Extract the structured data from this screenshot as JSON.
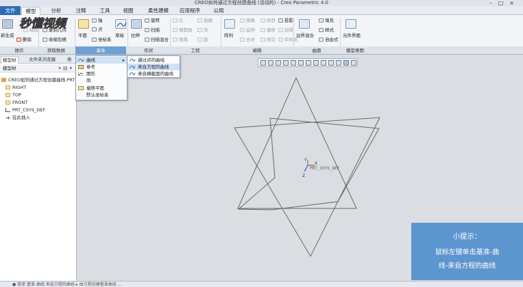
{
  "window": {
    "title": "CREO如何通过方程创建曲线 (活动的) - Creo Parametric 4.0"
  },
  "tabs": [
    "文件",
    "模型",
    "分析",
    "注释",
    "工具",
    "视图",
    "柔性建模",
    "应用程序",
    "公用"
  ],
  "logo_text": "秒懂视频",
  "ribbon": {
    "operations": {
      "regenerate": "新生成",
      "paste": "粘贴",
      "delete": "删除",
      "group_label": "操作"
    },
    "get_data": {
      "copy_geometry": "复制几何",
      "shrinkwrap": "收缩包络",
      "group_label": "获取数据"
    },
    "datum": {
      "plane": "平面",
      "axis": "轴",
      "point": "点",
      "coord_sys": "坐标系",
      "sketch": "草绘",
      "group_label": "基准"
    },
    "shapes": {
      "extrude": "拉伸",
      "revolve": "旋转",
      "sweep": "扫描",
      "swept_blend": "扫描混合",
      "group_label": "形状"
    },
    "engineering": {
      "hole": "孔",
      "round": "倒圆角",
      "chamfer": "倒角",
      "draft": "拔模",
      "shell": "壳",
      "rib": "筋",
      "group_label": "工程"
    },
    "editing": {
      "pattern": "阵列",
      "mirror": "镜像",
      "extend": "延伸",
      "merge": "合并",
      "trim": "修剪",
      "offset": "偏移",
      "intersect": "相交",
      "project": "投影",
      "thicken": "加厚",
      "solidify": "实体化",
      "group_label": "编辑"
    },
    "surfaces": {
      "boundary_blend": "边界混合",
      "fill": "填充",
      "style": "样式",
      "freestyle": "自由式",
      "group_label": "曲面"
    },
    "model_intent": {
      "component_interface": "元件界面",
      "group_label": "模型意图"
    }
  },
  "left_panel": {
    "tabs": [
      "模型树",
      "文件夹浏览器",
      "收藏夹"
    ],
    "tree_header": "模型树",
    "items": [
      "CREO如何通过方程创建曲线.PRT",
      "RIGHT",
      "TOP",
      "FRONT",
      "PRT_CSYS_DEF",
      "在此插入"
    ]
  },
  "datum_menu": {
    "items": [
      "曲线",
      "参考",
      "图形",
      "简",
      "偏移平面",
      "默认坐标系"
    ]
  },
  "curve_submenu": {
    "items": [
      "通过点的曲线",
      "来自方程的曲线",
      "来自横截面的曲线"
    ]
  },
  "model": {
    "csys_label": "PRT_CSYS_DEF",
    "axis_x": "X",
    "axis_y": "Y",
    "axis_z": "Z"
  },
  "tip": {
    "title": "小提示：",
    "line1": "鼠标左键单击基准-曲",
    "line2": "线-来自方程的曲线"
  },
  "status": {
    "text": "● 菜单 基准 曲线 来自方程的曲线 ▸ 由方程创建基准曲线 ..."
  },
  "colors": {
    "file_tab": "#2e6cb5",
    "datum_group_highlight": "#6f9fd3",
    "tip_bg": "#5d96cf",
    "menu_highlight": "#cfe2f6",
    "model_lines": "#6b6468"
  }
}
